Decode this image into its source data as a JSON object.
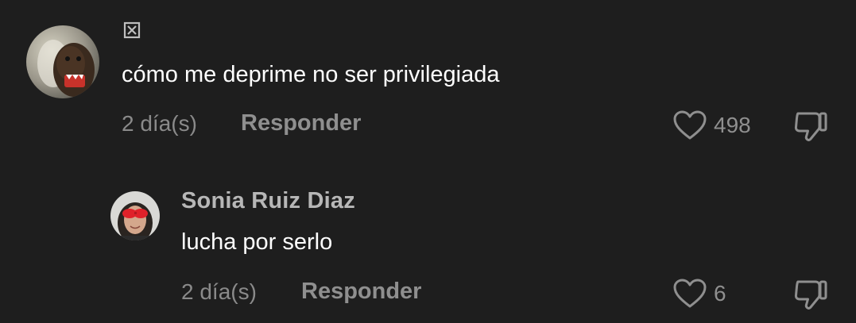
{
  "comments": [
    {
      "author_name": "",
      "name_icon": "broken-glyph-icon",
      "avatar_icon": "domo-plush-avatar",
      "text": "cómo me deprime no ser privilegiada",
      "time": "2 día(s)",
      "reply_label": "Responder",
      "likes": "498",
      "like_icon": "heart-outline-icon",
      "dislike_icon": "thumbs-down-icon"
    },
    {
      "author_name": "Sonia Ruiz Diaz",
      "avatar_icon": "user-photo-avatar",
      "text": "lucha por serlo",
      "time": "2 día(s)",
      "reply_label": "Responder",
      "likes": "6",
      "like_icon": "heart-outline-icon",
      "dislike_icon": "thumbs-down-icon"
    }
  ],
  "colors": {
    "background": "#1e1e1e",
    "primary_text": "#ffffff",
    "secondary_text": "#8f8f8f",
    "username": "#b7b7b7"
  }
}
